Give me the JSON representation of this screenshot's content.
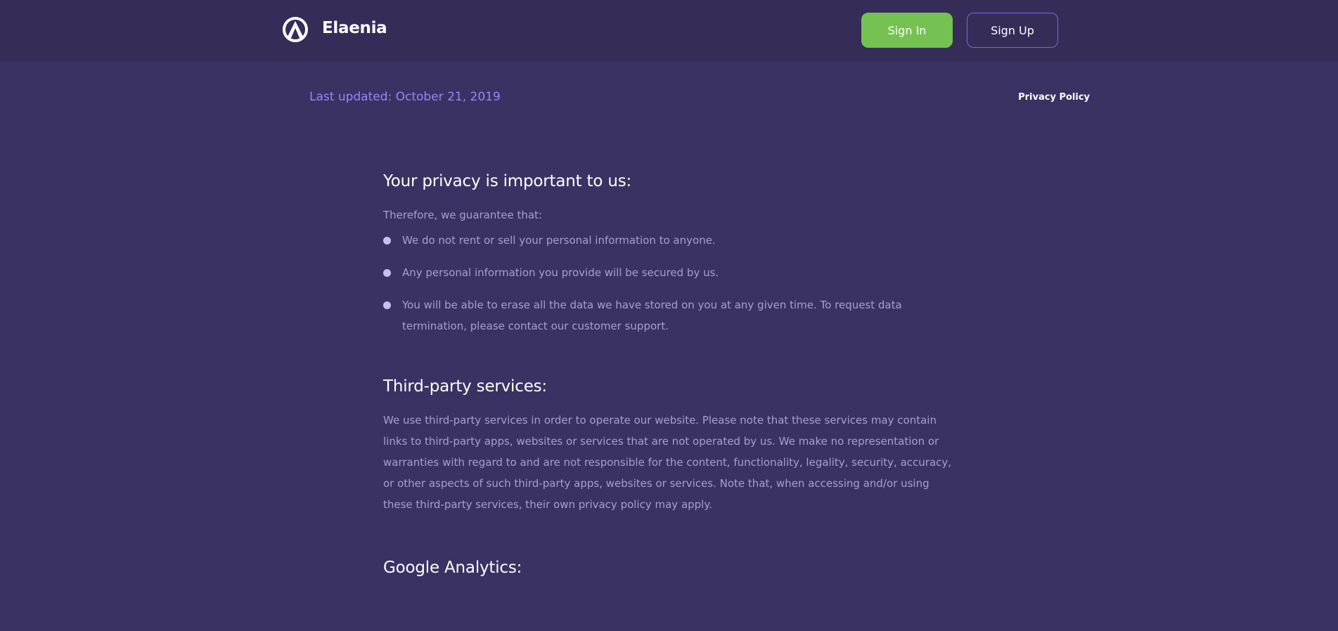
{
  "header": {
    "brand": "Elaenia",
    "logo_icon": "elaenia-logo-icon",
    "signin_label": "Sign In",
    "signup_label": "Sign Up"
  },
  "meta": {
    "last_updated": "Last updated: October 21, 2019",
    "breadcrumb": "Privacy Policy"
  },
  "sections": {
    "privacy": {
      "title": "Your privacy is important to us:",
      "intro": "Therefore, we guarantee that:",
      "items": [
        "We do not rent or sell your personal information to anyone.",
        "Any personal information you provide will be secured by us.",
        "You will be able to erase all the data we have stored on you at any given time. To request data termination, please contact our customer support."
      ]
    },
    "third_party": {
      "title": "Third-party services:",
      "body": "We use third-party services in order to operate our website. Please note that these services may contain links to third-party apps, websites or services that are not operated by us. We make no representation or warranties with regard to and are not responsible for the content, functionality, legality, security, accuracy, or other aspects of such third-party apps, websites or services. Note that, when accessing and/or using these third-party services, their own privacy policy may apply."
    },
    "analytics": {
      "title": "Google Analytics:"
    }
  },
  "colors": {
    "background": "#3a3262",
    "header": "#352d58",
    "accent_green": "#75c253",
    "accent_purple": "#7b66e6",
    "date_text": "#9a84ff",
    "body_text": "#a99fcf"
  }
}
